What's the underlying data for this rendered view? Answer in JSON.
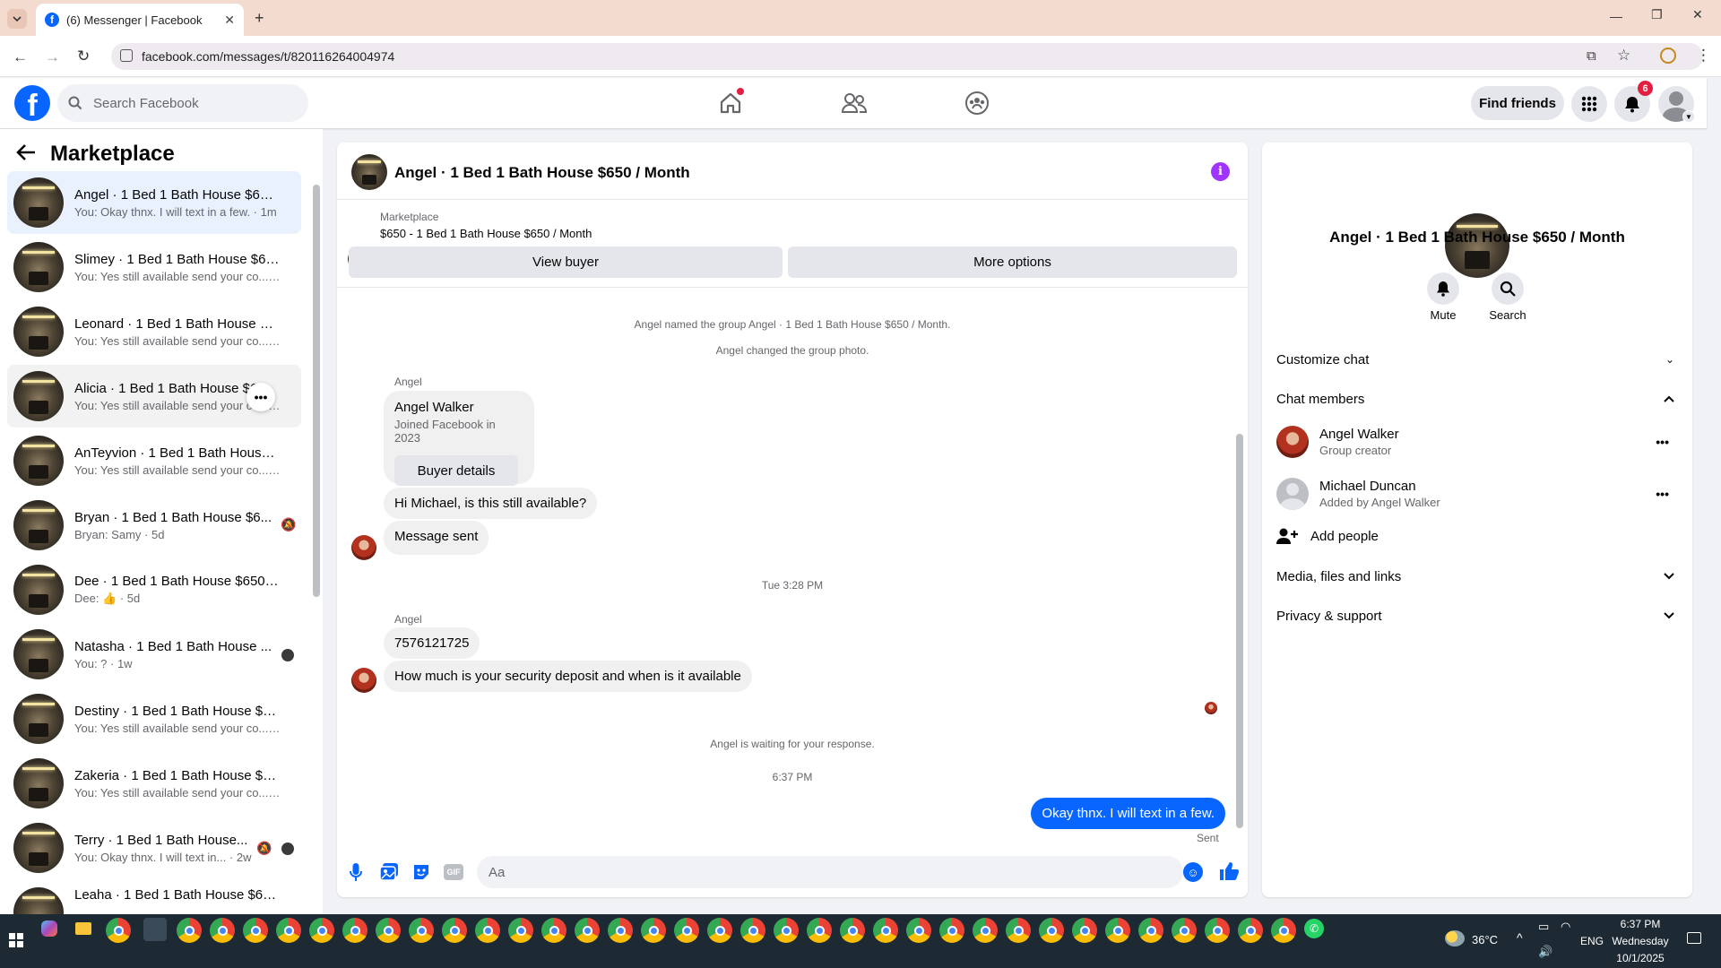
{
  "browser": {
    "tab_title": "(6) Messenger | Facebook",
    "url": "facebook.com/messages/t/820116264004974"
  },
  "topbar": {
    "search_placeholder": "Search Facebook",
    "find_friends": "Find friends",
    "notifications_count": "6"
  },
  "sidebar": {
    "title": "Marketplace",
    "conversations": [
      {
        "name": "Angel · 1 Bed 1 Bath House $650...",
        "preview": "You: Okay thnx. I will text in a few. · 1m"
      },
      {
        "name": "Slimey · 1 Bed 1 Bath House $65...",
        "preview": "You: Yes still available send your co... · 1h"
      },
      {
        "name": "Leonard · 1 Bed 1 Bath House $6...",
        "preview": "You: Yes still available send your co... · 1h"
      },
      {
        "name": "Alicia · 1 Bed 1 Bath House $6...",
        "preview": "You: Yes still available send your co... · 1d"
      },
      {
        "name": "AnTeyvion · 1 Bed 1 Bath House ...",
        "preview": "You: Yes still available send your co... · 1d"
      },
      {
        "name": "Bryan · 1 Bed 1 Bath House $6...",
        "preview": "Bryan: Samy · 5d"
      },
      {
        "name": "Dee · 1 Bed 1 Bath House $650 / ...",
        "preview": "Dee: 👍 · 5d"
      },
      {
        "name": "Natasha · 1 Bed 1 Bath House ...",
        "preview": "You: ? · 1w"
      },
      {
        "name": "Destiny · 1 Bed 1 Bath House $65...",
        "preview": "You: Yes still available send your co... · 1w"
      },
      {
        "name": "Zakeria · 1 Bed 1 Bath House $65...",
        "preview": "You: Yes still available send your co... · 1w"
      },
      {
        "name": "Terry · 1 Bed 1 Bath House...",
        "preview": "You: Okay thnx. I will text in... · 2w"
      },
      {
        "name": "Leaha · 1 Bed 1 Bath House $650...",
        "preview": ""
      }
    ]
  },
  "chat": {
    "title": "Angel · 1 Bed 1 Bath House $650 / Month",
    "listing_source": "Marketplace",
    "listing_title": "$650 - 1 Bed 1 Bath House $650 / Month",
    "view_buyer": "View buyer",
    "more_options": "More options",
    "sys_named": "Angel named the group Angel · 1 Bed 1 Bath House $650 / Month.",
    "sys_photo": "Angel changed the group photo.",
    "sender1": "Angel",
    "card_name": "Angel Walker",
    "card_sub": "Joined Facebook in 2023",
    "buyer_details": "Buyer details",
    "msg1": "Hi Michael, is this still available?",
    "msg2": "Message sent",
    "time1": "Tue 3:28 PM",
    "sender2": "Angel",
    "msg3": "7576121725",
    "msg4": "How much is your security deposit and when is it available",
    "sys_waiting": "Angel is waiting for your response.",
    "time2": "6:37 PM",
    "my_msg": "Okay thnx. I will text in a few.",
    "sent": "Sent",
    "composer_placeholder": "Aa"
  },
  "details": {
    "title": "Angel · 1 Bed 1 Bath House $650 / Month",
    "mute": "Mute",
    "search": "Search",
    "customize": "Customize chat",
    "members_header": "Chat members",
    "members": [
      {
        "name": "Angel Walker",
        "sub": "Group creator"
      },
      {
        "name": "Michael Duncan",
        "sub": "Added by Angel Walker"
      }
    ],
    "add_people": "Add people",
    "media": "Media, files and links",
    "privacy": "Privacy & support"
  },
  "taskbar": {
    "weather": "36°C",
    "lang": "ENG",
    "time": "6:37 PM",
    "day": "Wednesday",
    "date": "10/1/2025"
  },
  "colors": {
    "fb_blue": "#0866ff",
    "accent_purple": "#a033ff",
    "notification_red": "#e41e3f"
  }
}
